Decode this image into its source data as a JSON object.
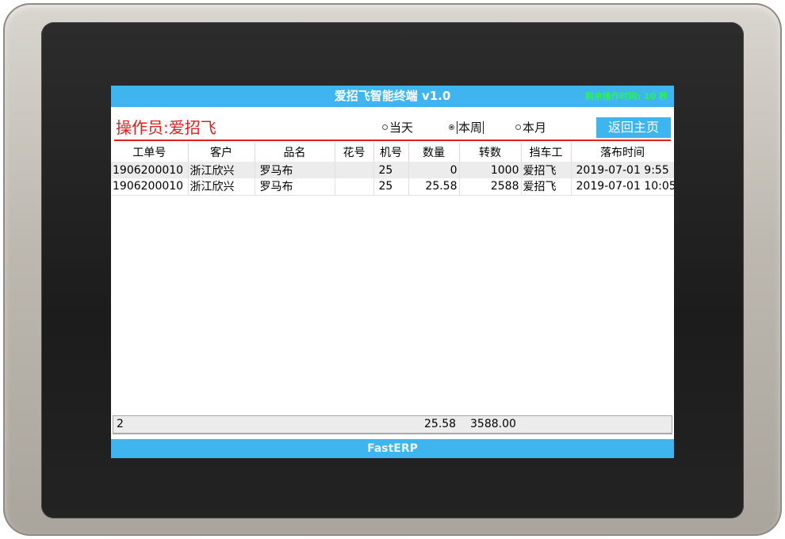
{
  "window": {
    "title": "爱招飞智能终端 v1.0",
    "countdown": "剩余操作时间: 10 秒"
  },
  "header": {
    "operator": "操作员:爱招飞",
    "filters": [
      {
        "label": "当天",
        "checked": false
      },
      {
        "label": "本周",
        "checked": true
      },
      {
        "label": "本月",
        "checked": false
      }
    ],
    "home_button": "返回主页"
  },
  "table": {
    "columns": [
      "工单号",
      "客户",
      "品名",
      "花号",
      "机号",
      "数量",
      "转数",
      "挡车工",
      "落布时间"
    ],
    "rows": [
      [
        "1906200010",
        "浙江欣兴",
        "罗马布",
        "",
        "25",
        "0",
        "1000",
        "爱招飞",
        "2019-07-01 9:55"
      ],
      [
        "1906200010",
        "浙江欣兴",
        "罗马布",
        "",
        "25",
        "25.58",
        "2588",
        "爱招飞",
        "2019-07-01 10:05"
      ]
    ]
  },
  "summary": {
    "count": "2",
    "qty_total": "25.58",
    "turns_total": "3588.00"
  },
  "footer": {
    "label": "FastERP"
  },
  "colors": {
    "accent": "#3fb5f0",
    "operator_red": "#e02020",
    "countdown_green": "#2cf05a"
  }
}
